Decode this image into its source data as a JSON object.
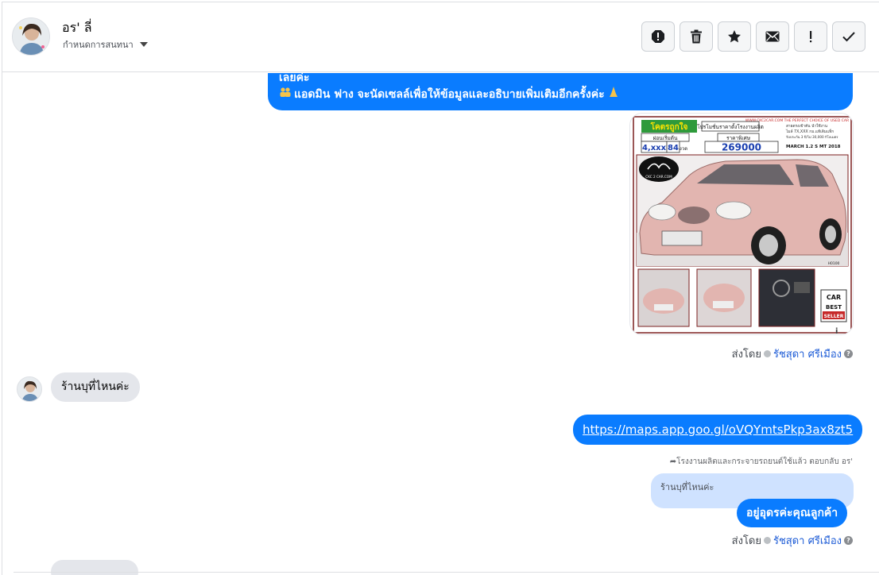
{
  "contact": {
    "name": "อร' ลี่",
    "assign_label": "กำหนดการสนทนา"
  },
  "header_actions": [
    {
      "icon": "spam-alert-icon"
    },
    {
      "icon": "trash-icon"
    },
    {
      "icon": "star-icon"
    },
    {
      "icon": "mail-icon"
    },
    {
      "icon": "exclamation-icon"
    },
    {
      "icon": "checkmark-icon"
    }
  ],
  "messages": {
    "m1_line1": "เลยค่ะ",
    "m1_line2": "แอดมิน ฟาง จะนัดเซลล์เพื่อให้ข้อมูลและอธิบายเพิ่มเติมอีกครั้งค่ะ",
    "incoming_question": "ร้านบุที่ไหนค่ะ",
    "maps_link": "https://maps.app.goo.gl/oVQYmtsPkp3ax8zt5",
    "reply_note": "โรงงานผลิตและกระจายรถยนต์ใช้แล้ว ตอบกลับ อร'",
    "quoted_text": "ร้านบุที่ไหนค่ะ",
    "reply_text": "อยู่อุดรค่ะคุณลูกค้า"
  },
  "sent_by": {
    "label": "ส่งโดย",
    "name": "รัชสุดา ศรีเมือง"
  },
  "ad_image": {
    "site": "WWW.CKC2CAR.COM  THE PERFECT CHOICE OF USED CAR",
    "tag_left": "โคตรถูกใจ",
    "promo_title": "โปรโมชั่นราคาตั้งโรงงานผลิต",
    "down_label": "ผ่อนเริ่มต้น",
    "installment": "4,xxx",
    "months": "84",
    "months_unit": "งวด",
    "price_label": "ราคาพิเศษ",
    "price": "269000",
    "specs_line1": "สายตรงเข้าคัน นำใช้งาน",
    "specs_line2": "ไมล์ 7X,XXX กม.แท้เดิมแท็ก",
    "specs_line3": "รับประกัน 3 ปี/ไม่ 30,000 กิโลเมตร",
    "model": "MARCH 1.2 S MT 2018",
    "logo": "CKC 2 CAR.COM",
    "stock_code": "H0100",
    "badge_line1": "CAR",
    "badge_line2": "BEST",
    "badge_line3": "SELLER"
  },
  "colors": {
    "outgoing_bubble": "#0a7cff",
    "incoming_bubble": "#e4e6eb",
    "quoted_bubble": "#cfe2ff",
    "car_pink": "#e2b5b0"
  }
}
